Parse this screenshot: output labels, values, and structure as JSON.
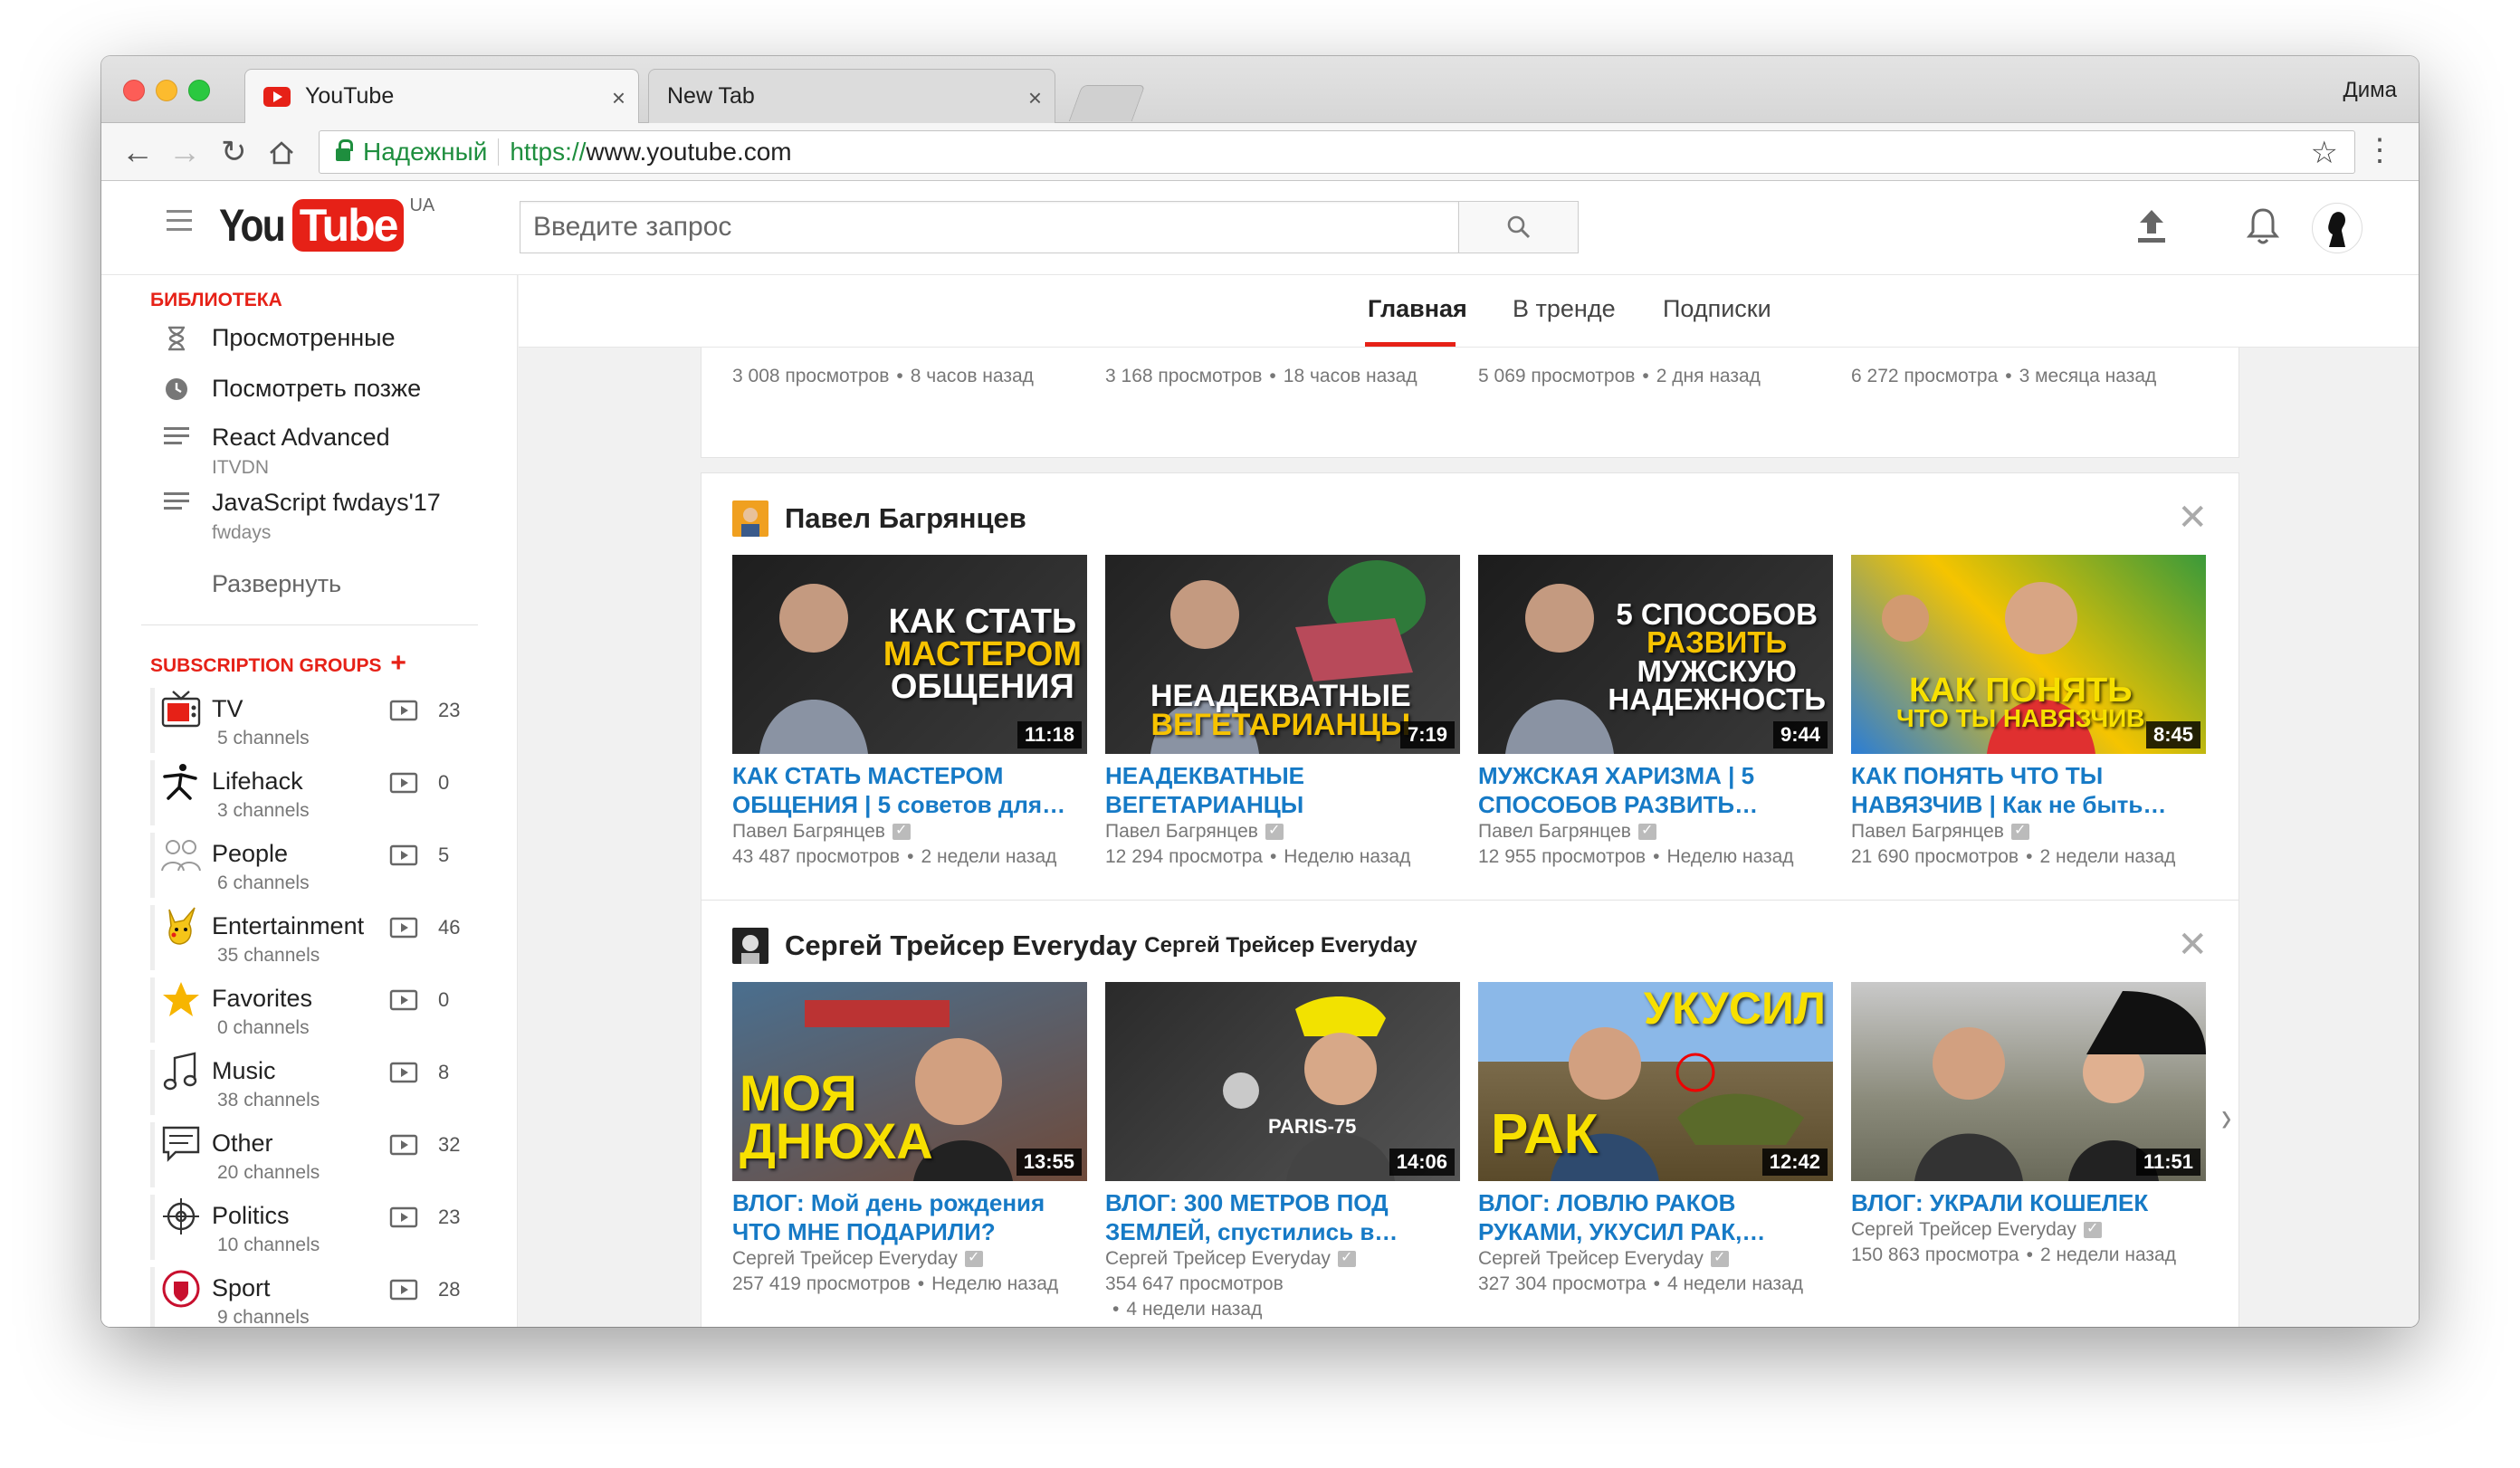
{
  "browser": {
    "tabs": [
      {
        "title": "YouTube"
      },
      {
        "title": "New Tab"
      }
    ],
    "profile": "Дима",
    "secure_label": "Надежный",
    "url_scheme": "https://",
    "url_host": "www.youtube.com"
  },
  "masthead": {
    "logo_you": "You",
    "logo_tube": "Tube",
    "region": "UA",
    "search_placeholder": "Введите запрос"
  },
  "sidebar": {
    "library_title": "БИБЛИОТЕКА",
    "library": [
      {
        "label": "Просмотренные",
        "sub": ""
      },
      {
        "label": "Посмотреть позже",
        "sub": ""
      },
      {
        "label": "React Advanced",
        "sub": "ITVDN"
      },
      {
        "label": "JavaScript fwdays'17",
        "sub": "fwdays"
      }
    ],
    "expand_label": "Развернуть",
    "groups_title": "SUBSCRIPTION GROUPS",
    "groups_plus": "+",
    "groups": [
      {
        "name": "TV",
        "channels": "5 channels",
        "count": "23",
        "icon": "tv-icon"
      },
      {
        "name": "Lifehack",
        "channels": "3 channels",
        "count": "0",
        "icon": "runner-icon"
      },
      {
        "name": "People",
        "channels": "6 channels",
        "count": "5",
        "icon": "people-icon"
      },
      {
        "name": "Entertainment",
        "channels": "35 channels",
        "count": "46",
        "icon": "pikachu-icon"
      },
      {
        "name": "Favorites",
        "channels": "0 channels",
        "count": "0",
        "icon": "star-icon"
      },
      {
        "name": "Music",
        "channels": "38 channels",
        "count": "8",
        "icon": "music-note-icon"
      },
      {
        "name": "Other",
        "channels": "20 channels",
        "count": "32",
        "icon": "chat-icon"
      },
      {
        "name": "Politics",
        "channels": "10 channels",
        "count": "23",
        "icon": "crosshair-icon"
      },
      {
        "name": "Sport",
        "channels": "9 channels",
        "count": "28",
        "icon": "club-badge-icon"
      }
    ]
  },
  "main_tabs": [
    {
      "label": "Главная",
      "active": true
    },
    {
      "label": "В тренде",
      "active": false
    },
    {
      "label": "Подписки",
      "active": false
    }
  ],
  "top_row": [
    {
      "meta": "3 008 просмотров",
      "age": "8 часов назад"
    },
    {
      "meta": "3 168 просмотров",
      "age": "18 часов назад"
    },
    {
      "meta": "5 069 просмотров",
      "age": "2 дня назад"
    },
    {
      "meta": "6 272 просмотра",
      "age": "3 месяца назад"
    }
  ],
  "shelves": [
    {
      "title": "Павел Багрянцев",
      "subtitle": "",
      "videos": [
        {
          "thumb_text": [
            "КАК СТАТЬ",
            "МАСТЕРОМ",
            "ОБЩЕНИЯ"
          ],
          "duration": "11:18",
          "title": "КАК СТАТЬ МАСТЕРОМ ОБЩЕНИЯ | 5 советов для…",
          "channel": "Павел Багрянцев",
          "views": "43 487 просмотров",
          "age": "2 недели назад"
        },
        {
          "thumb_text": [
            "НЕАДЕКВАТНЫЕ",
            "ВЕГЕТАРИАНЦЫ"
          ],
          "duration": "7:19",
          "title": "НЕАДЕКВАТНЫЕ ВЕГЕТАРИАНЦЫ",
          "channel": "Павел Багрянцев",
          "views": "12 294 просмотра",
          "age": "Неделю назад"
        },
        {
          "thumb_text": [
            "5 СПОСОБОВ",
            "РАЗВИТЬ",
            "МУЖСКУЮ",
            "НАДЕЖНОСТЬ"
          ],
          "duration": "9:44",
          "title": "МУЖСКАЯ ХАРИЗМА | 5 СПОСОБОВ РАЗВИТЬ…",
          "channel": "Павел Багрянцев",
          "views": "12 955 просмотров",
          "age": "Неделю назад"
        },
        {
          "thumb_text": [
            "КАК ПОНЯТЬ",
            "ЧТО ТЫ НАВЯЗЧИВ"
          ],
          "duration": "8:45",
          "title": "КАК ПОНЯТЬ ЧТО ТЫ НАВЯЗЧИВ | Как не быть…",
          "channel": "Павел Багрянцев",
          "views": "21 690 просмотров",
          "age": "2 недели назад"
        }
      ]
    },
    {
      "title": "Сергей Трейсер Everyday",
      "subtitle": "Сергей Трейсер Everyday",
      "videos": [
        {
          "thumb_text": [
            "МОЯ",
            "ДНЮХА"
          ],
          "duration": "13:55",
          "title": "ВЛОГ: Мой день рождения ЧТО МНЕ ПОДАРИЛИ?",
          "channel": "Сергей Трейсер Everyday",
          "views": "257 419 просмотров",
          "age": "Неделю назад"
        },
        {
          "thumb_text": [
            "PARIS-75"
          ],
          "duration": "14:06",
          "title": "ВЛОГ: 300 МЕТРОВ ПОД ЗЕМЛЕЙ, спустились в…",
          "channel": "Сергей Трейсер Everyday",
          "views": "354 647 просмотров",
          "age": "4 недели назад"
        },
        {
          "thumb_text": [
            "УКУСИЛ",
            "РАК"
          ],
          "duration": "12:42",
          "title": "ВЛОГ: ЛОВЛЮ РАКОВ РУКАМИ, УКУСИЛ РАК,…",
          "channel": "Сергей Трейсер Everyday",
          "views": "327 304 просмотра",
          "age": "4 недели назад"
        },
        {
          "thumb_text": [],
          "duration": "11:51",
          "title": "ВЛОГ: УКРАЛИ КОШЕЛЕК",
          "channel": "Сергей Трейсер Everyday",
          "views": "150 863 просмотра",
          "age": "2 недели назад"
        }
      ]
    }
  ],
  "colors": {
    "brand_red": "#e62117",
    "link_blue": "#167ac6"
  }
}
